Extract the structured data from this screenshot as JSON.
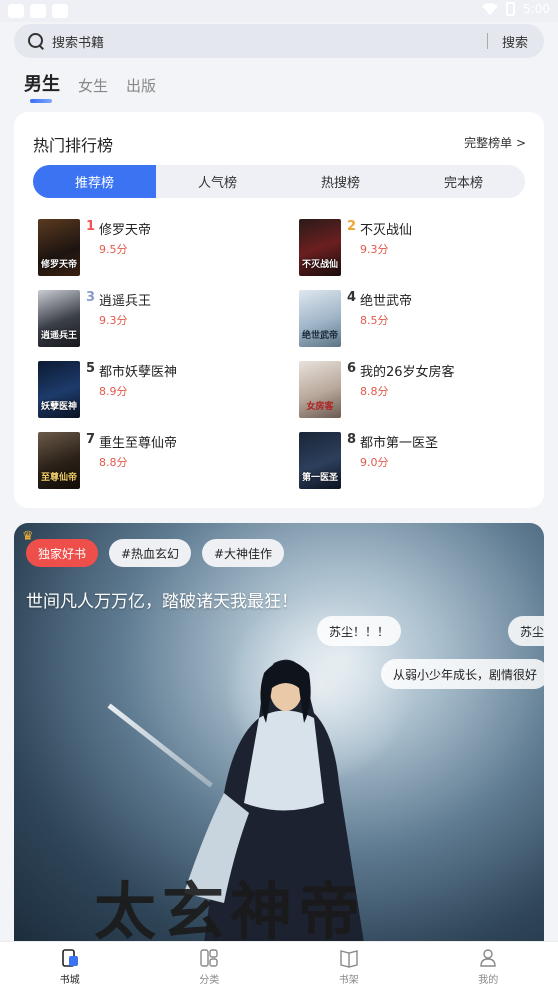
{
  "status": {
    "time": "5:00"
  },
  "search": {
    "placeholder": "搜索书籍",
    "button": "搜索"
  },
  "gender_tabs": [
    {
      "label": "男生",
      "active": true
    },
    {
      "label": "女生"
    },
    {
      "label": "出版"
    }
  ],
  "ranking": {
    "title": "热门排行榜",
    "more": "完整榜单 >",
    "tabs": [
      {
        "label": "推荐榜",
        "active": true
      },
      {
        "label": "人气榜"
      },
      {
        "label": "热搜榜"
      },
      {
        "label": "完本榜"
      }
    ],
    "books": [
      {
        "rank": "1",
        "name": "修罗天帝",
        "score": "9.5分",
        "cover_text": "修罗天帝"
      },
      {
        "rank": "2",
        "name": "不灭战仙",
        "score": "9.3分",
        "cover_text": "不灭战仙"
      },
      {
        "rank": "3",
        "name": "逍遥兵王",
        "score": "9.3分",
        "cover_text": "逍遥兵王"
      },
      {
        "rank": "4",
        "name": "绝世武帝",
        "score": "8.5分",
        "cover_text": "绝世武帝"
      },
      {
        "rank": "5",
        "name": "都市妖孽医神",
        "score": "8.9分",
        "cover_text": "妖孽医神"
      },
      {
        "rank": "6",
        "name": "我的26岁女房客",
        "score": "8.8分",
        "cover_text": "女房客"
      },
      {
        "rank": "7",
        "name": "重生至尊仙帝",
        "score": "8.8分",
        "cover_text": "至尊仙帝"
      },
      {
        "rank": "8",
        "name": "都市第一医圣",
        "score": "9.0分",
        "cover_text": "第一医圣"
      }
    ]
  },
  "banner": {
    "tags": [
      "独家好书",
      "#热血玄幻",
      "#大神佳作"
    ],
    "slogan": "世间凡人万万亿，踏破诸天我最狂！",
    "comments": [
      "苏尘！！！",
      "苏尘",
      "从弱小少年成长，剧情很好"
    ],
    "logo": "太玄神帝"
  },
  "nav": [
    {
      "label": "书城",
      "icon": "bookstore-icon",
      "active": true
    },
    {
      "label": "分类",
      "icon": "category-icon"
    },
    {
      "label": "书架",
      "icon": "bookshelf-icon"
    },
    {
      "label": "我的",
      "icon": "profile-icon"
    }
  ],
  "colors": {
    "accent": "#3b73f3",
    "hot": "#ef4f4b",
    "score": "#e15a4c"
  }
}
